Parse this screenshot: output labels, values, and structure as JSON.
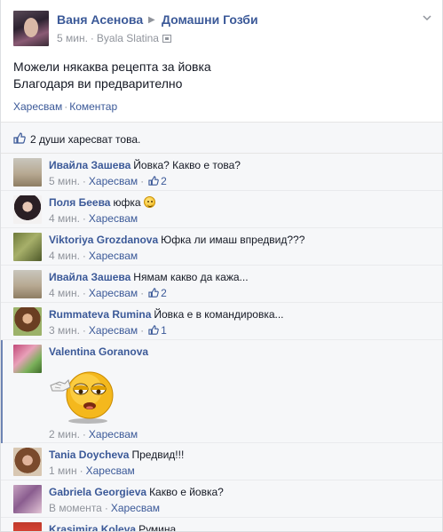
{
  "post": {
    "author": "Ваня Асенова",
    "group": "Домашни Гозби",
    "time": "5 мин.",
    "location": "Byala Slatina",
    "text_line1": "Можели някаква рецепта за йовка",
    "text_line2": "Благодаря ви предварително",
    "like_label": "Харесвам",
    "comment_label": "Коментар",
    "likes_summary": "2 души харесват това."
  },
  "comments": [
    {
      "name": "Ивайла Зашева",
      "text": "Йовка? Какво е това?",
      "time": "5 мин.",
      "like_label": "Харесвам",
      "likes": "2"
    },
    {
      "name": "Поля Беева",
      "text": "юфка",
      "time": "4 мин.",
      "like_label": "Харесвам",
      "likes": ""
    },
    {
      "name": "Viktoriya Grozdanova",
      "text": "Юфка ли имаш впредвид???",
      "time": "4 мин.",
      "like_label": "Харесвам",
      "likes": ""
    },
    {
      "name": "Ивайла Зашева",
      "text": "Нямам какво да кажа...",
      "time": "4 мин.",
      "like_label": "Харесвам",
      "likes": "2"
    },
    {
      "name": "Rummateva Rumina",
      "text": "Йовка е в командировка...",
      "time": "3 мин.",
      "like_label": "Харесвам",
      "likes": "1"
    },
    {
      "name": "Valentina Goranova",
      "text": "",
      "time": "2 мин.",
      "like_label": "Харесвам",
      "likes": ""
    },
    {
      "name": "Tania Doycheva",
      "text": "Предвид!!!",
      "time": "1 мин",
      "like_label": "Харесвам",
      "likes": ""
    },
    {
      "name": "Gabriela Georgieva",
      "text": "Какво е йовка?",
      "time": "В момента",
      "like_label": "Харесвам",
      "likes": ""
    },
    {
      "name": "Krasimira Koleva",
      "text": "Румина",
      "time": "",
      "like_label": "",
      "likes": ""
    }
  ],
  "icons": {
    "like": "thumbs-up-icon",
    "emoticon": "smile-icon",
    "menu": "chevron-down-icon",
    "place": "place-icon"
  },
  "colors": {
    "link": "#3b5998",
    "meta": "#90949c",
    "comment_bg": "#f6f7f9",
    "accent": "#6d84b4"
  }
}
